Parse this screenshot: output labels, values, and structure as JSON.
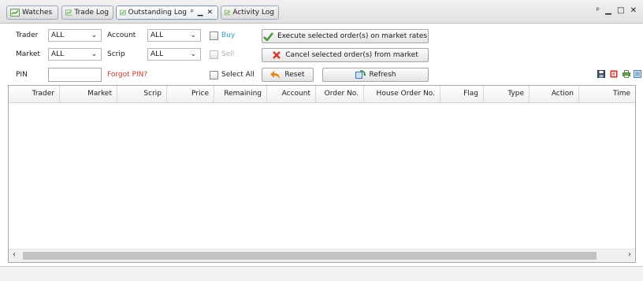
{
  "tabs": [
    {
      "label": "Watches"
    },
    {
      "label": "Trade Log"
    },
    {
      "label": "Outstanding Log",
      "active": true
    },
    {
      "label": "Activity Log"
    }
  ],
  "tab_controls": "ᵖ ▁ ✕",
  "window_controls": "ᵖ ▁ □ ✕",
  "filters": {
    "trader": {
      "label": "Trader",
      "value": "ALL"
    },
    "account": {
      "label": "Account",
      "value": "ALL"
    },
    "market": {
      "label": "Market",
      "value": "ALL"
    },
    "scrip": {
      "label": "Scrip",
      "value": "ALL"
    },
    "pin": {
      "label": "PIN",
      "value": ""
    },
    "forgot_pin": "Forgot PIN?",
    "buy": {
      "label": "Buy",
      "checked": false
    },
    "sell": {
      "label": "Sell",
      "checked": false,
      "disabled": true
    },
    "select_all": {
      "label": "Select All",
      "checked": false
    }
  },
  "buttons": {
    "execute": "Execute selected order(s) on market rates",
    "cancel": "Cancel selected order(s) from market",
    "reset": "Reset",
    "refresh": "Refresh"
  },
  "toolbar_icons": [
    "save-icon",
    "pdf-icon",
    "print-icon",
    "columns-icon"
  ],
  "grid": {
    "columns": [
      "Trader",
      "Market",
      "Scrip",
      "Price",
      "Remaining",
      "Account",
      "Order No.",
      "House Order No.",
      "Flag",
      "Type",
      "Action",
      "Time"
    ],
    "rows": []
  },
  "colors": {
    "accent_blue": "#2aa3c2",
    "link_red": "#c0392b",
    "disabled_text": "#b0b0b0",
    "check_green": "#3f9a2c",
    "cross_red": "#d33a2c",
    "reset_orange": "#e08a1e"
  }
}
